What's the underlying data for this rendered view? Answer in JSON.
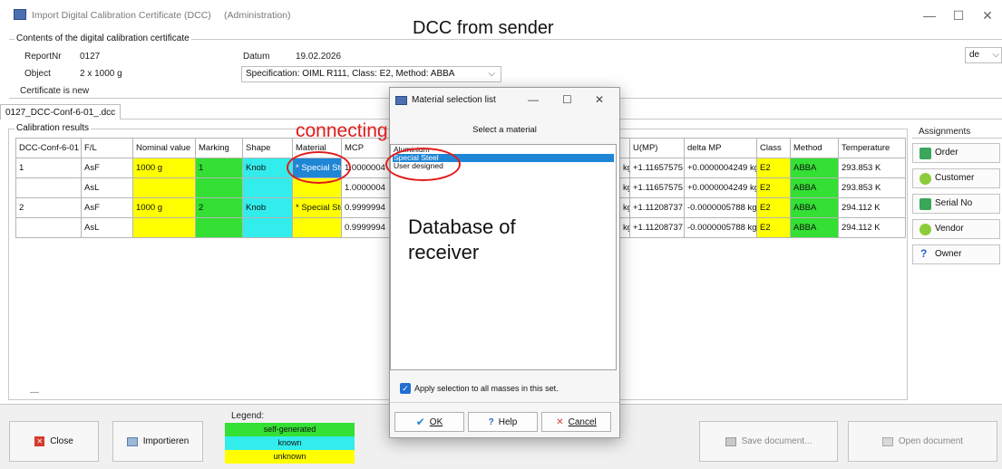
{
  "header": {
    "app_title": "Import Digital Calibration Certificate (DCC)",
    "admin_label": "(Administration)",
    "big_heading": "Import Digital Calibration Certificate (DCC) - connecting to the receiver's database",
    "annotation_sender": "DCC from sender",
    "contents_label": "Contents of the digital calibration certificate",
    "language_value": "de",
    "window_controls": [
      "—",
      "☐",
      "✕"
    ]
  },
  "certificate": {
    "report_label": "ReportNr",
    "report_value": "0127",
    "object_label": "Object",
    "object_value": "2 x 1000 g",
    "status_text": "Certificate is new",
    "date_label": "Datum",
    "date_value": "19.02.2026",
    "spec_value": "Specification: OIML R111,   Class: E2,   Method: ABBA"
  },
  "tab_label": "0127_DCC-Conf-6-01_.dcc",
  "calibration": {
    "group_label": "Calibration results",
    "columns": [
      "DCC-Conf-6-01",
      "F/L",
      "Nominal value",
      "Marking",
      "Shape",
      "Material",
      "MCP"
    ],
    "rows": [
      [
        "1",
        "AsF",
        "1000 g",
        "1",
        "Knob",
        "* Special Steel",
        "1.0000004"
      ],
      [
        "",
        "AsL",
        "",
        "",
        "",
        "",
        "1.0000004"
      ],
      [
        "2",
        "AsF",
        "1000 g",
        "2",
        "Knob",
        "* Special Steel",
        "0.9999994"
      ],
      [
        "",
        "AsL",
        "",
        "",
        "",
        "",
        "0.9999994"
      ]
    ],
    "right_columns": [
      "",
      "U(MP)",
      "delta MP",
      "Class",
      "Method",
      "Temperature"
    ],
    "right_rows": [
      [
        "kg",
        "+1.11657575",
        "+0.0000004249 kg",
        "E2",
        "ABBA",
        "293.853 K"
      ],
      [
        "kg",
        "+1.11657575",
        "+0.0000004249 kg",
        "E2",
        "ABBA",
        "293.853 K"
      ],
      [
        "kg",
        "+1.11208737",
        "-0.0000005788 kg",
        "E2",
        "ABBA",
        "294.112 K"
      ],
      [
        "kg",
        "+1.11208737",
        "-0.0000005788 kg",
        "E2",
        "ABBA",
        "294.112 K"
      ]
    ],
    "bottom_dash": "—"
  },
  "annotations": {
    "connecting": "connecting",
    "database_line1": "Database of",
    "database_line2": "receiver"
  },
  "assignments": {
    "label": "Assignments",
    "buttons": [
      {
        "label": "Order",
        "icon": "order-icon",
        "color": "#3aa65a"
      },
      {
        "label": "Customer",
        "icon": "customer-check-icon",
        "color": "#8ccc3a"
      },
      {
        "label": "Serial No",
        "icon": "serial-icon",
        "color": "#3aa65a"
      },
      {
        "label": "Vendor",
        "icon": "vendor-check-icon",
        "color": "#8ccc3a"
      },
      {
        "label": "Owner",
        "icon": "question-icon",
        "color": "#2a66c8"
      }
    ]
  },
  "dialog": {
    "title": "Material selection list",
    "prompt": "Select a material",
    "materials": [
      "Aluminium",
      "Special Steel",
      "User designed"
    ],
    "selected_index": 1,
    "apply_label": "Apply selection to all masses in this set.",
    "apply_checked": true,
    "ok_label": "OK",
    "help_label": "Help",
    "cancel_label": "Cancel"
  },
  "footer": {
    "close_label": "Close",
    "import_label": "Importieren",
    "legend_label": "Legend:",
    "legend_items": [
      {
        "label": "self-generated",
        "color": "#33e033"
      },
      {
        "label": "known",
        "color": "#33ecec"
      },
      {
        "label": "unknown",
        "color": "#ffff00"
      }
    ],
    "save_label": "Save document...",
    "open_label": "Open document"
  },
  "colors": {
    "selection": "#1f86d6",
    "annotation_red": "#e21b1b"
  }
}
